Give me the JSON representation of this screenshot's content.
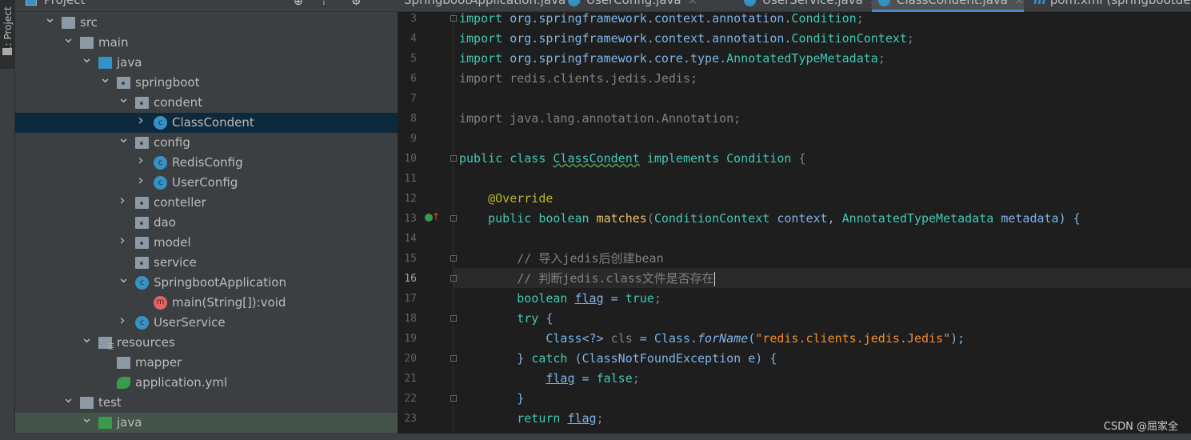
{
  "left_strip": {
    "label": "1: Project"
  },
  "project": {
    "title": "Project",
    "tree": [
      {
        "label": "src",
        "depth": 0,
        "exp": "open",
        "icon": "folder"
      },
      {
        "label": "main",
        "depth": 1,
        "exp": "open",
        "icon": "folder"
      },
      {
        "label": "java",
        "depth": 2,
        "exp": "open",
        "icon": "folder-blue"
      },
      {
        "label": "springboot",
        "depth": 3,
        "exp": "open",
        "icon": "package"
      },
      {
        "label": "condent",
        "depth": 4,
        "exp": "open",
        "icon": "package"
      },
      {
        "label": "ClassCondent",
        "depth": 5,
        "exp": "closed",
        "icon": "class",
        "selected": true
      },
      {
        "label": "config",
        "depth": 4,
        "exp": "open",
        "icon": "package"
      },
      {
        "label": "RedisConfig",
        "depth": 5,
        "exp": "closed",
        "icon": "class"
      },
      {
        "label": "UserConfig",
        "depth": 5,
        "exp": "closed",
        "icon": "class"
      },
      {
        "label": "conteller",
        "depth": 4,
        "exp": "closed",
        "icon": "package"
      },
      {
        "label": "dao",
        "depth": 4,
        "exp": "none",
        "icon": "package"
      },
      {
        "label": "model",
        "depth": 4,
        "exp": "closed",
        "icon": "package"
      },
      {
        "label": "service",
        "depth": 4,
        "exp": "none",
        "icon": "package"
      },
      {
        "label": "SpringbootApplication",
        "depth": 4,
        "exp": "open",
        "icon": "class"
      },
      {
        "label": "main(String[]):void",
        "depth": 5,
        "exp": "none",
        "icon": "method"
      },
      {
        "label": "UserService",
        "depth": 4,
        "exp": "closed",
        "icon": "class"
      },
      {
        "label": "resources",
        "depth": 2,
        "exp": "open",
        "icon": "resources"
      },
      {
        "label": "mapper",
        "depth": 3,
        "exp": "none",
        "icon": "folder"
      },
      {
        "label": "application.yml",
        "depth": 3,
        "exp": "none",
        "icon": "yml"
      },
      {
        "label": "test",
        "depth": 1,
        "exp": "open",
        "icon": "folder"
      },
      {
        "label": "java",
        "depth": 2,
        "exp": "open",
        "icon": "folder-green",
        "highlight": true
      }
    ]
  },
  "tabs": [
    {
      "label": "SpringbootApplication.java",
      "icon": "none"
    },
    {
      "label": "UserConfig.java",
      "icon": "class"
    },
    {
      "label": "UserService.java",
      "icon": "class"
    },
    {
      "label": "ClassCondent.java",
      "icon": "class",
      "active": true
    },
    {
      "label": "pom.xml (springbootde",
      "icon": "maven"
    }
  ],
  "editor": {
    "current_line": 16,
    "lines": [
      {
        "n": 3,
        "t": [
          [
            "import",
            "k"
          ],
          [
            " org.springframework.context.annotation.",
            "pl"
          ],
          [
            "Condition",
            "ty"
          ],
          [
            ";",
            "dim"
          ]
        ]
      },
      {
        "n": 4,
        "t": [
          [
            "import",
            "k"
          ],
          [
            " org.springframework.context.annotation.",
            "pl"
          ],
          [
            "ConditionContext",
            "ty"
          ],
          [
            ";",
            "dim"
          ]
        ]
      },
      {
        "n": 5,
        "t": [
          [
            "import",
            "k"
          ],
          [
            " org.springframework.core.type.",
            "pl"
          ],
          [
            "AnnotatedTypeMetadata",
            "ty"
          ],
          [
            ";",
            "dim"
          ]
        ]
      },
      {
        "n": 6,
        "t": [
          [
            "import redis.clients.jedis.Jedis;",
            "dim"
          ]
        ]
      },
      {
        "n": 7,
        "t": []
      },
      {
        "n": 8,
        "t": [
          [
            "import java.lang.annotation.Annotation;",
            "dim"
          ]
        ]
      },
      {
        "n": 9,
        "t": []
      },
      {
        "n": 10,
        "t": [
          [
            "public class ",
            "k"
          ],
          [
            "ClassCondent",
            "ty wv"
          ],
          [
            " implements ",
            "k"
          ],
          [
            "Condition",
            "ty"
          ],
          [
            " {",
            "dim"
          ]
        ]
      },
      {
        "n": 11,
        "t": []
      },
      {
        "n": 12,
        "t": [
          [
            "    ",
            ""
          ],
          [
            "@Override",
            "an"
          ]
        ]
      },
      {
        "n": 13,
        "t": [
          [
            "    ",
            ""
          ],
          [
            "public boolean ",
            "k"
          ],
          [
            "matches",
            "fn"
          ],
          [
            "(",
            "dim"
          ],
          [
            "ConditionContext",
            "ty"
          ],
          [
            " context, ",
            "pl"
          ],
          [
            "AnnotatedTypeMetadata",
            "ty"
          ],
          [
            " metadata) {",
            "pl"
          ]
        ]
      },
      {
        "n": 14,
        "t": []
      },
      {
        "n": 15,
        "t": [
          [
            "        // 导入jedis后创建bean",
            "cm"
          ]
        ]
      },
      {
        "n": 16,
        "t": [
          [
            "        // 判断jedis.class文件是否存在",
            "cm"
          ]
        ],
        "caret": true
      },
      {
        "n": 17,
        "t": [
          [
            "        ",
            ""
          ],
          [
            "boolean ",
            "k"
          ],
          [
            "flag",
            "pl ul"
          ],
          [
            " = ",
            "pl"
          ],
          [
            "true",
            "k"
          ],
          [
            ";",
            "dim"
          ]
        ]
      },
      {
        "n": 18,
        "t": [
          [
            "        ",
            ""
          ],
          [
            "try",
            "k"
          ],
          [
            " {",
            "pl"
          ]
        ]
      },
      {
        "n": 19,
        "t": [
          [
            "            ",
            ""
          ],
          [
            "Class",
            "ty2"
          ],
          [
            "<?> ",
            "pl"
          ],
          [
            "cls",
            "dim"
          ],
          [
            " = ",
            "pl"
          ],
          [
            "Class.",
            "ty2"
          ],
          [
            "forName",
            "it"
          ],
          [
            "(",
            "pl"
          ],
          [
            "\"redis.clients.jedis.Jedis\"",
            "st"
          ],
          [
            ");",
            "pl"
          ]
        ]
      },
      {
        "n": 20,
        "t": [
          [
            "        } ",
            "pl"
          ],
          [
            "catch",
            "k"
          ],
          [
            " (ClassNotFoundException e) {",
            "pl"
          ]
        ]
      },
      {
        "n": 21,
        "t": [
          [
            "            ",
            ""
          ],
          [
            "flag",
            "pl ul"
          ],
          [
            " = ",
            "pl"
          ],
          [
            "false",
            "k"
          ],
          [
            ";",
            "dim"
          ]
        ]
      },
      {
        "n": 22,
        "t": [
          [
            "        }",
            "pl"
          ]
        ]
      },
      {
        "n": 23,
        "t": [
          [
            "        ",
            ""
          ],
          [
            "return ",
            "k"
          ],
          [
            "flag",
            "pl ul"
          ],
          [
            ";",
            "dim"
          ]
        ]
      }
    ]
  },
  "watermark": "CSDN @屈家全",
  "colors": {
    "keyword": "#41c7b5",
    "identifier": "#7fb2e6",
    "string": "#f08c2e",
    "comment": "#808080",
    "annotation": "#bbb529",
    "selection": "#0d293e",
    "accent": "#4a88c7"
  }
}
